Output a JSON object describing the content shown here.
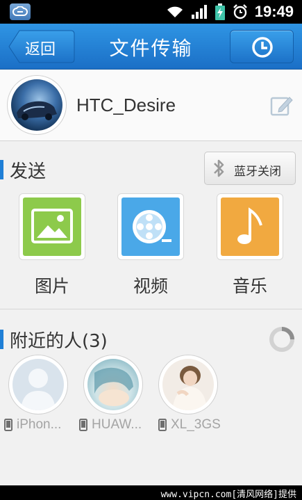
{
  "status_bar": {
    "time": "19:49",
    "icons": [
      "app-cloud-icon",
      "wifi-icon",
      "signal-icon",
      "battery-charging-icon",
      "alarm-clock-icon"
    ]
  },
  "header": {
    "back_label": "返回",
    "title": "文件传输",
    "history_icon": "clock-icon"
  },
  "profile": {
    "device_name": "HTC_Desire",
    "edit_icon": "edit-icon"
  },
  "send_section": {
    "title": "发送",
    "bluetooth_label": "蓝牙关闭",
    "items": [
      {
        "label": "图片",
        "icon": "picture-icon",
        "color": "#8dca4b"
      },
      {
        "label": "视频",
        "icon": "film-reel-icon",
        "color": "#4aa8e8"
      },
      {
        "label": "音乐",
        "icon": "music-note-icon",
        "color": "#f1a940"
      }
    ]
  },
  "nearby_section": {
    "title": "附近的人(3)",
    "people": [
      {
        "name": "iPhon..."
      },
      {
        "name": "HUAW..."
      },
      {
        "name": "XL_3GS"
      }
    ]
  },
  "watermark": "www.vipcn.com[清风网络]提供",
  "colors": {
    "header": "#2586d8",
    "accent": "#1f7fd6",
    "background": "#f1f1f1"
  }
}
